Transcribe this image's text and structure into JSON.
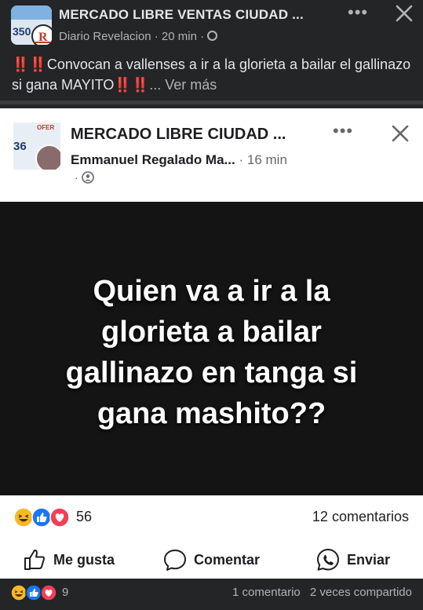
{
  "outer_post": {
    "title": "MERCADO LIBRE VENTAS CIUDAD ...",
    "author": "Diario Revelacion",
    "time": "20 min",
    "separator": "·",
    "text_prefix": "‼️‼️",
    "text_body": "Convocan a vallenses a ir a la glorieta a bailar el gallinazo si gana MAYITO",
    "text_suffix": "‼️‼️",
    "see_more": "... Ver más"
  },
  "shared_post": {
    "title": "MERCADO LIBRE CIUDAD ...",
    "author": "Emmanuel Regalado Ma...",
    "time": "16 min",
    "separator": "·",
    "avatar_text_top": "OFER",
    "avatar_text_number": "36",
    "image_text_lines": [
      "Quien va a ir a la",
      "glorieta a bailar",
      "gallinazo en tanga si",
      "gana mashito??"
    ],
    "reactions_count": "56",
    "comments_count": "12 comentarios",
    "actions": {
      "like": "Me gusta",
      "comment": "Comentar",
      "send": "Enviar"
    }
  },
  "bottom_bar": {
    "reactions_count": "9",
    "comments": "1 comentario",
    "shares": "2 veces compartido"
  },
  "colors": {
    "dark_bg": "#242526",
    "like_blue": "#1877f2",
    "love_red": "#f33e58",
    "haha_yellow": "#f7b928"
  }
}
